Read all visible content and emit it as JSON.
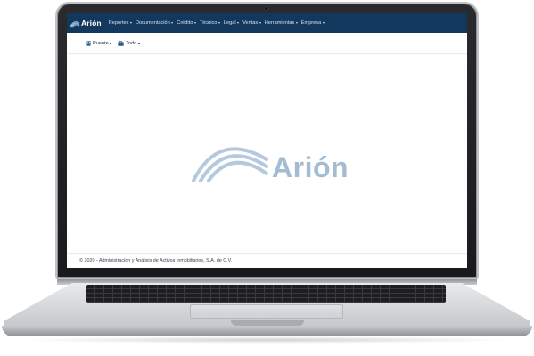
{
  "navbar": {
    "brand": "Arión",
    "menu": [
      {
        "label": "Reportes"
      },
      {
        "label": "Documentación"
      },
      {
        "label": "Crédito"
      },
      {
        "label": "Técnico"
      },
      {
        "label": "Legal"
      },
      {
        "label": "Ventas"
      },
      {
        "label": "Herramientas"
      },
      {
        "label": "Empresa"
      }
    ]
  },
  "subbar": {
    "dropdowns": [
      {
        "label": "Puente",
        "icon": "building-icon"
      },
      {
        "label": "Todo",
        "icon": "briefcase-icon"
      }
    ]
  },
  "main": {
    "logo_text": "Arión"
  },
  "footer": {
    "text": "© 2020 - Administración y Análisis de Activos Inmobiliarios, S.A. de C.V."
  },
  "colors": {
    "navbar": "#12385e",
    "logo": "#a4bcd2"
  }
}
